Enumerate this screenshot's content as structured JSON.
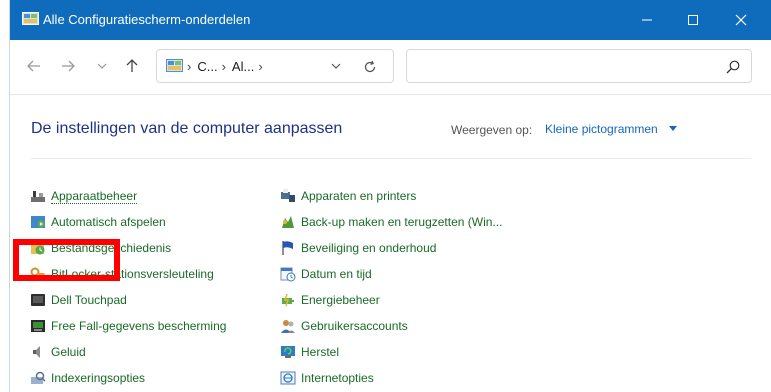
{
  "window": {
    "title": "Alle Configuratiescherm-onderdelen",
    "controls": {
      "minimize": "minimize-icon",
      "maximize": "maximize-icon",
      "close": "close-icon"
    }
  },
  "navigation": {
    "back_icon": "arrow-left-icon",
    "forward_icon": "arrow-right-icon",
    "recent_icon": "chevron-down-icon",
    "up_icon": "arrow-up-icon"
  },
  "address": {
    "crumbs": [
      "C...",
      "Al..."
    ],
    "dropdown_icon": "chevron-down-icon",
    "refresh_icon": "refresh-icon"
  },
  "search": {
    "placeholder": "",
    "icon": "search-icon"
  },
  "header": {
    "heading": "De instellingen van de computer aanpassen",
    "view_by_label": "Weergeven op:",
    "view_by_value": "Kleine pictogrammen"
  },
  "items_left": [
    {
      "label": "Apparaatbeheer",
      "icon": "device-manager-icon"
    },
    {
      "label": "Automatisch afspelen",
      "icon": "autoplay-icon"
    },
    {
      "label": "Bestandsgeschiedenis",
      "icon": "file-history-icon"
    },
    {
      "label": "BitLocker-stationsversleuteling",
      "icon": "bitlocker-icon"
    },
    {
      "label": "Dell Touchpad",
      "icon": "touchpad-icon"
    },
    {
      "label": "Free Fall-gegevens bescherming",
      "icon": "free-fall-icon"
    },
    {
      "label": "Geluid",
      "icon": "speaker-icon"
    },
    {
      "label": "Indexeringsopties",
      "icon": "indexing-icon"
    }
  ],
  "items_right": [
    {
      "label": "Apparaten en printers",
      "icon": "printer-icon"
    },
    {
      "label": "Back-up maken en terugzetten (Win...",
      "icon": "backup-icon"
    },
    {
      "label": "Beveiliging en onderhoud",
      "icon": "flag-icon"
    },
    {
      "label": "Datum en tijd",
      "icon": "calendar-clock-icon"
    },
    {
      "label": "Energiebeheer",
      "icon": "power-icon"
    },
    {
      "label": "Gebruikersaccounts",
      "icon": "users-icon"
    },
    {
      "label": "Herstel",
      "icon": "recovery-icon"
    },
    {
      "label": "Internetopties",
      "icon": "internet-options-icon"
    }
  ],
  "colors": {
    "titlebar": "#0f6cbd",
    "link_green": "#1a6a27",
    "heading_blue": "#1e3287",
    "highlight": "#ff0000"
  }
}
